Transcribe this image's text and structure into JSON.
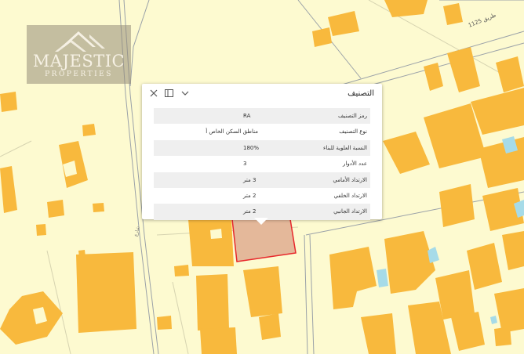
{
  "map": {
    "colors": {
      "background": "#fdfad0",
      "building": "#f8b93d",
      "road": "#9aa1a8",
      "water": "#a6dbe8",
      "selected_parcel_fill": "#e4b89a",
      "selected_parcel_border": "#e8282c"
    },
    "road_label": "طريق 1125",
    "road_label_2": "شارع"
  },
  "logo": {
    "name": "MAJESTIC",
    "subtitle": "PROPERTIES"
  },
  "popup": {
    "title": "التصنيف",
    "controls": [
      "chevron-down-icon",
      "dock-icon",
      "close-icon"
    ],
    "rows": [
      {
        "label": "رمز التصنيف",
        "value": "RA"
      },
      {
        "label": "نوع التصنيف",
        "value": "مناطق السكن الخاص أ"
      },
      {
        "label": "النسبة العلوية للبناء",
        "value": "180%"
      },
      {
        "label": "عدد الأدوار",
        "value": "3"
      },
      {
        "label": "الارتداد الأمامي",
        "value": "3 متر"
      },
      {
        "label": "الارتداد الخلفي",
        "value": "2 متر"
      },
      {
        "label": "الارتداد الجانبي",
        "value": "2 متر"
      }
    ]
  }
}
